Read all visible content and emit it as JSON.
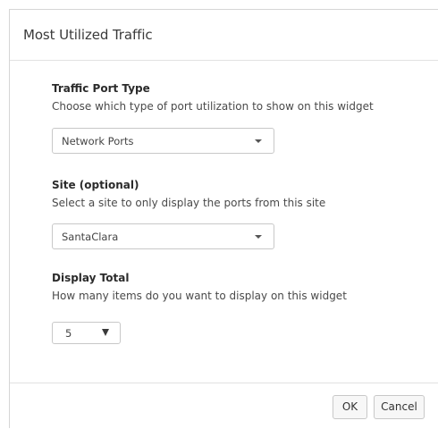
{
  "dialog": {
    "title": "Most Utilized Traffic"
  },
  "traffic_port_type": {
    "label": "Traffic Port Type",
    "help": "Choose which type of port utilization to show on this widget",
    "selected": "Network Ports"
  },
  "site": {
    "label": "Site (optional)",
    "help": "Select a site to only display the ports from this site",
    "selected": "SantaClara"
  },
  "display_total": {
    "label": "Display Total",
    "help": "How many items do you want to display on this widget",
    "selected": "5"
  },
  "footer": {
    "ok_label": "OK",
    "cancel_label": "Cancel"
  },
  "icons": {
    "dropdown": "caret-down-icon"
  }
}
